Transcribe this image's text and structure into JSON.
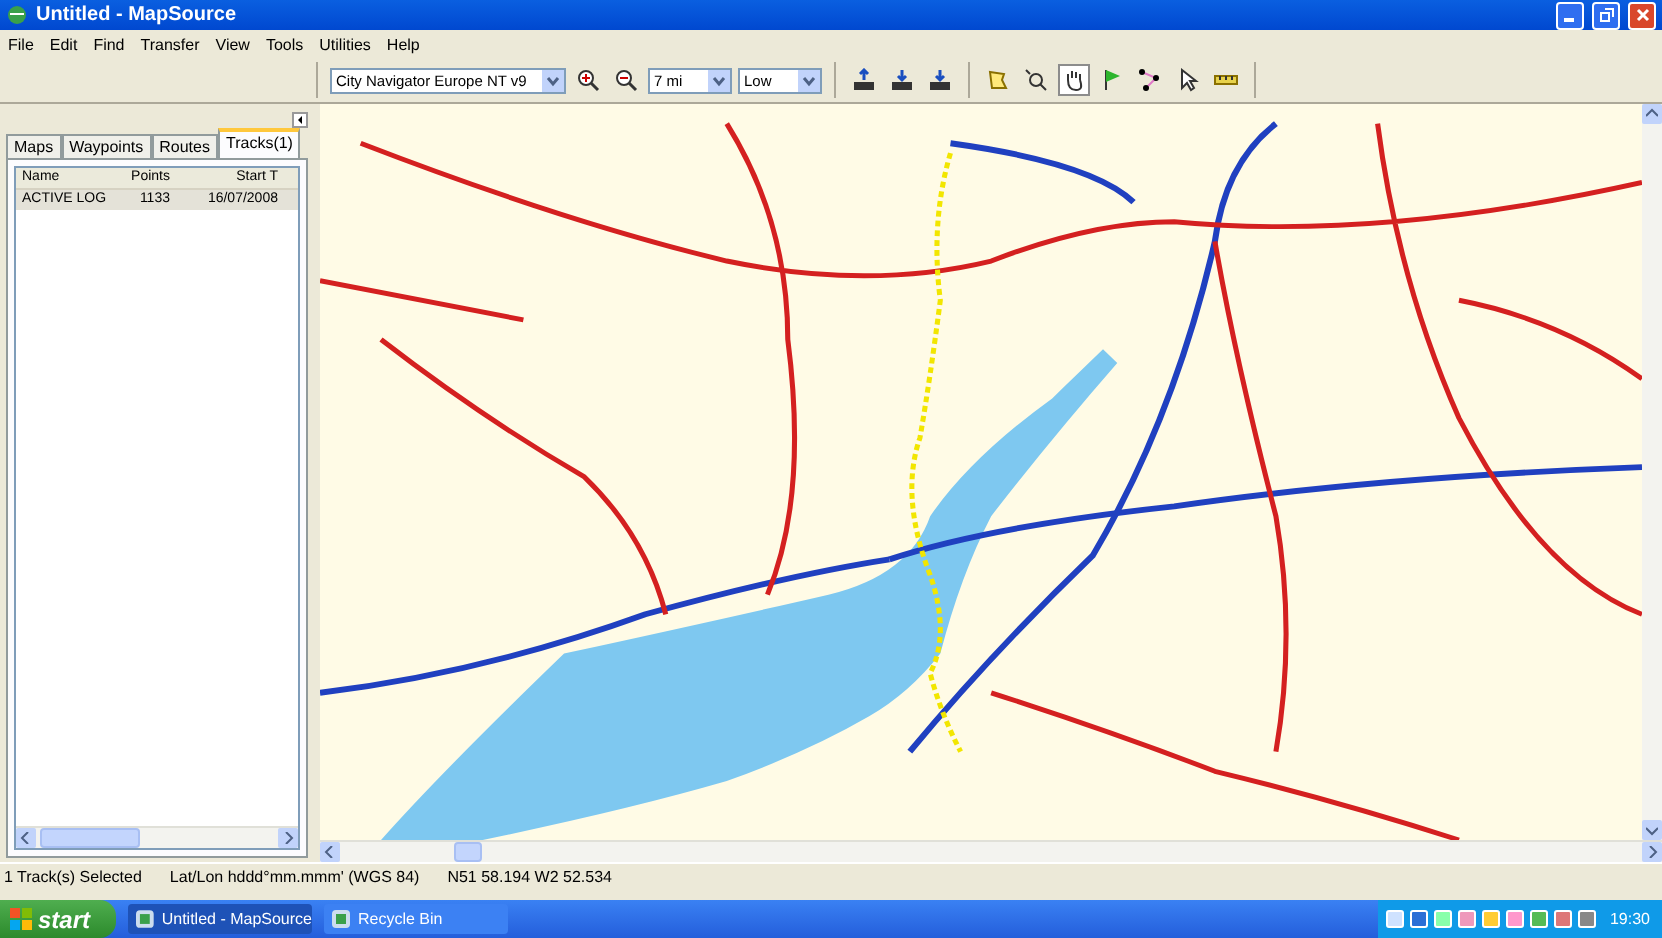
{
  "window": {
    "title": "Untitled - MapSource"
  },
  "menu": [
    "File",
    "Edit",
    "Find",
    "Transfer",
    "View",
    "Tools",
    "Utilities",
    "Help"
  ],
  "toolbar": {
    "map_product": "City Navigator Europe NT v9",
    "zoom": "7 mi",
    "detail": "Low",
    "tools": [
      {
        "kind": "zoom-in",
        "selected": false
      },
      {
        "kind": "zoom-out",
        "selected": false
      },
      {
        "kind": "upload",
        "selected": false
      },
      {
        "kind": "download",
        "selected": false
      },
      {
        "kind": "download2",
        "selected": false
      },
      {
        "kind": "map",
        "selected": false
      },
      {
        "kind": "zoom-tool",
        "selected": false
      },
      {
        "kind": "pan",
        "selected": true
      },
      {
        "kind": "flag",
        "selected": false
      },
      {
        "kind": "route",
        "selected": false
      },
      {
        "kind": "select",
        "selected": false
      },
      {
        "kind": "ruler",
        "selected": false
      }
    ]
  },
  "tabs": [
    {
      "label": "Maps",
      "selected": false
    },
    {
      "label": "Waypoints",
      "selected": false
    },
    {
      "label": "Routes",
      "selected": false
    },
    {
      "label": "Tracks(1)",
      "selected": true
    }
  ],
  "table": {
    "columns": [
      "Name",
      "Points",
      "Start T"
    ],
    "rows": [
      {
        "cells": [
          "ACTIVE LOG",
          "1133",
          "16/07/2008"
        ],
        "selected": true
      }
    ]
  },
  "status_bar": [
    "1 Track(s) Selected",
    "Lat/Lon hddd°mm.mmm' (WGS 84)",
    "N51 58.194 W2 52.534"
  ],
  "taskbar": {
    "start": "start",
    "tasks": [
      {
        "label": "Untitled - MapSource",
        "selected": true
      },
      {
        "label": "Recycle Bin",
        "selected": false
      }
    ],
    "clock": "19:30"
  }
}
